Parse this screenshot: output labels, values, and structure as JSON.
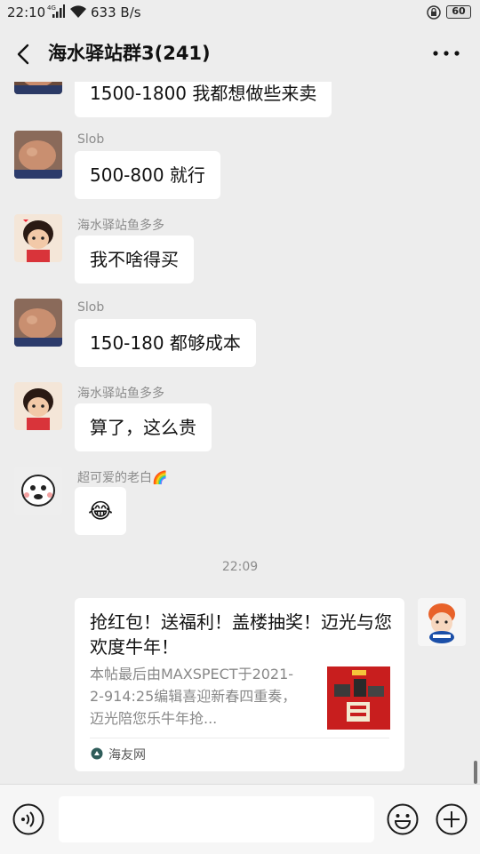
{
  "status_bar": {
    "time": "22:10",
    "signal_label": "4G",
    "speed": "633 B/s",
    "battery": "60"
  },
  "header": {
    "title": "海水驿站群3(241)"
  },
  "messages": [
    {
      "sender": "",
      "text": "1500-1800 我都想做些来卖"
    },
    {
      "sender": "Slob",
      "text": "500-800 就行"
    },
    {
      "sender": "海水驿站鱼多多",
      "text": "我不啥得买"
    },
    {
      "sender": "Slob",
      "text": "150-180 都够成本"
    },
    {
      "sender": "海水驿站鱼多多",
      "text": "算了，这么贵"
    },
    {
      "sender": "超可爱的老白🌈",
      "text": "😂"
    }
  ],
  "timestamp": "22:09",
  "card": {
    "title": "抢红包！送福利！盖楼抽奖！迈光与您欢度牛年！",
    "description": "本帖最后由MAXSPECT于2021-2-914:25编辑喜迎新春四重奏，迈光陪您乐牛年抢...",
    "source": "海友网"
  },
  "colors": {
    "chat_background": "#ededed",
    "bubble": "#ffffff",
    "sender_text": "#8c8c8c"
  }
}
